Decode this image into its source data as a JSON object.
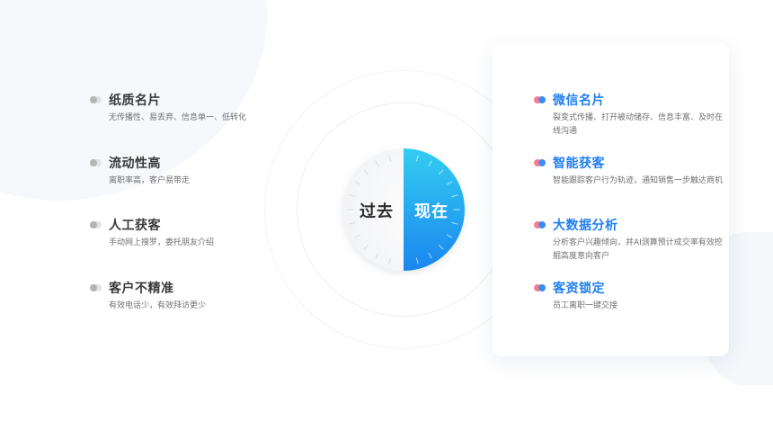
{
  "left_items": [
    {
      "title": "纸质名片",
      "desc": "无传播性、易丢弃、信息单一、低转化"
    },
    {
      "title": "流动性高",
      "desc": "离职率高，客户易带走"
    },
    {
      "title": "人工获客",
      "desc": "手动网上搜罗，委托朋友介绍"
    },
    {
      "title": "客户不精准",
      "desc": "有效电话少，有效拜访更少"
    }
  ],
  "right_items": [
    {
      "title": "微信名片",
      "desc": "裂变式传播、打开被动储存、信息丰富、及时在线沟通"
    },
    {
      "title": "智能获客",
      "desc": "智能跟踪客户行为轨迹，通知销售一步触达商机"
    },
    {
      "title": "大数据分析",
      "desc": "分析客户兴趣倾向，并AI测算预计成交率有效挖掘高度意向客户"
    },
    {
      "title": "客资锁定",
      "desc": "员工离职一键交接"
    }
  ],
  "center": {
    "past_label": "过去",
    "now_label": "现在"
  },
  "colors": {
    "accent_blue": "#1f7ff0",
    "gradient_top": "#33cdf0",
    "gradient_bottom": "#1c8cf0",
    "dot_red": "#ff7a8a",
    "dot_gray": "#b5b5b5"
  }
}
